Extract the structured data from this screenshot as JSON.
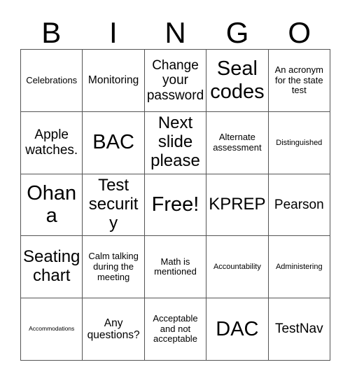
{
  "header": {
    "letters": [
      "B",
      "I",
      "N",
      "G",
      "O"
    ]
  },
  "grid": {
    "rows": 5,
    "columns": 5,
    "border_color": "#555555",
    "background": "#ffffff",
    "text_color": "#000000",
    "cells": [
      {
        "text": "Celebrations",
        "size": "sm"
      },
      {
        "text": "Monitoring",
        "size": "md"
      },
      {
        "text": "Change your password",
        "size": "lg"
      },
      {
        "text": "Seal codes",
        "size": "xxl"
      },
      {
        "text": "An acronym for the state test",
        "size": "sm"
      },
      {
        "text": "Apple watches.",
        "size": "lg"
      },
      {
        "text": "BAC",
        "size": "xxl"
      },
      {
        "text": "Next slide please",
        "size": "xl"
      },
      {
        "text": "Alternate assessment",
        "size": "sm"
      },
      {
        "text": "Distinguished",
        "size": "xs"
      },
      {
        "text": "Ohana",
        "size": "xxl"
      },
      {
        "text": "Test security",
        "size": "xl"
      },
      {
        "text": "Free!",
        "size": "xxl"
      },
      {
        "text": "KPREP",
        "size": "xl"
      },
      {
        "text": "Pearson",
        "size": "lg"
      },
      {
        "text": "Seating chart",
        "size": "xl"
      },
      {
        "text": "Calm talking during the meeting",
        "size": "sm"
      },
      {
        "text": "Math is mentioned",
        "size": "sm"
      },
      {
        "text": "Accountability",
        "size": "xs"
      },
      {
        "text": "Administering",
        "size": "xs"
      },
      {
        "text": "Accommodations",
        "size": "xxs"
      },
      {
        "text": "Any questions?",
        "size": "md"
      },
      {
        "text": "Acceptable and not acceptable",
        "size": "sm"
      },
      {
        "text": "DAC",
        "size": "xxl"
      },
      {
        "text": "TestNav",
        "size": "lg"
      }
    ]
  }
}
